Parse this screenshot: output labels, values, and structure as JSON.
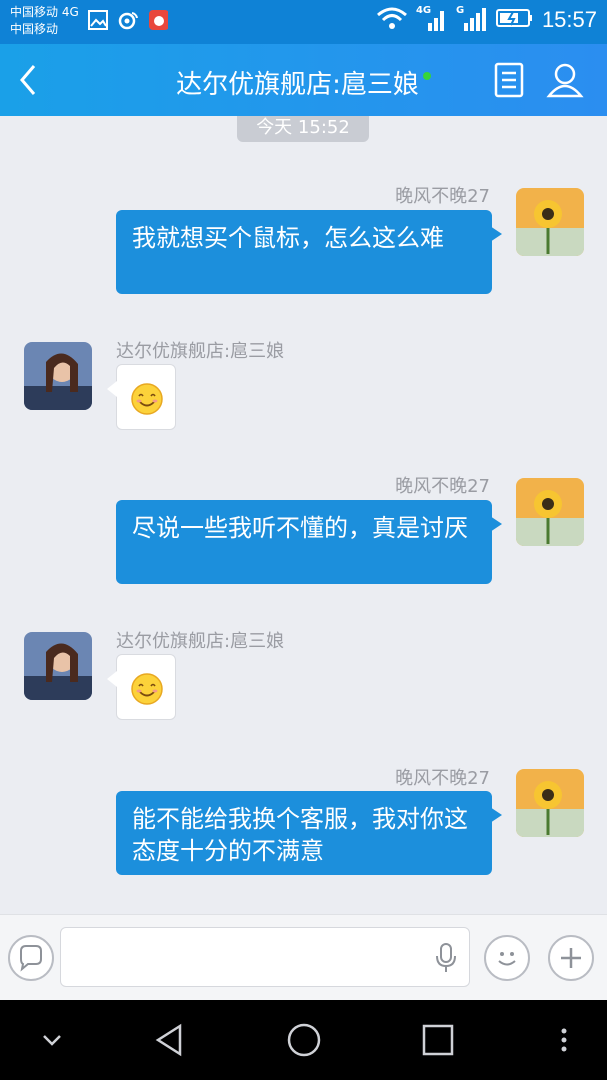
{
  "status_bar": {
    "carrier_line1": "中国移动 4G",
    "carrier_line2": "中国移动",
    "net_label_1": "4G",
    "net_label_2": "G",
    "time": "15:57",
    "icons": [
      "image-icon",
      "weibo-icon",
      "app-notification-icon",
      "wifi-icon",
      "signal-icon",
      "battery-charging-icon"
    ]
  },
  "header": {
    "title": "达尔优旗舰店:扈三娘",
    "online_color": "#37d43a",
    "icons": [
      "back-arrow-icon",
      "notes-icon",
      "profile-icon"
    ]
  },
  "chat": {
    "timestamp": "今天 15:52",
    "messages": [
      {
        "direction": "out",
        "sender": "晚风不晚27",
        "text": "我就想买个鼠标，怎么这么难"
      },
      {
        "direction": "in",
        "sender": "达尔优旗舰店:扈三娘",
        "emoji": "smiley"
      },
      {
        "direction": "out",
        "sender": "晚风不晚27",
        "text": "尽说一些我听不懂的，真是讨厌"
      },
      {
        "direction": "in",
        "sender": "达尔优旗舰店:扈三娘",
        "emoji": "smiley"
      },
      {
        "direction": "out",
        "sender": "晚风不晚27",
        "text": "能不能给我换个客服，我对你这态度十分的不满意"
      }
    ]
  },
  "input_bar": {
    "value": "",
    "icons": [
      "speech-bubble-icon",
      "microphone-icon",
      "emoji-icon",
      "plus-icon"
    ]
  },
  "colors": {
    "accent": "#1c8fdc",
    "header": "#2b8ef0",
    "background": "#ebedf2"
  }
}
